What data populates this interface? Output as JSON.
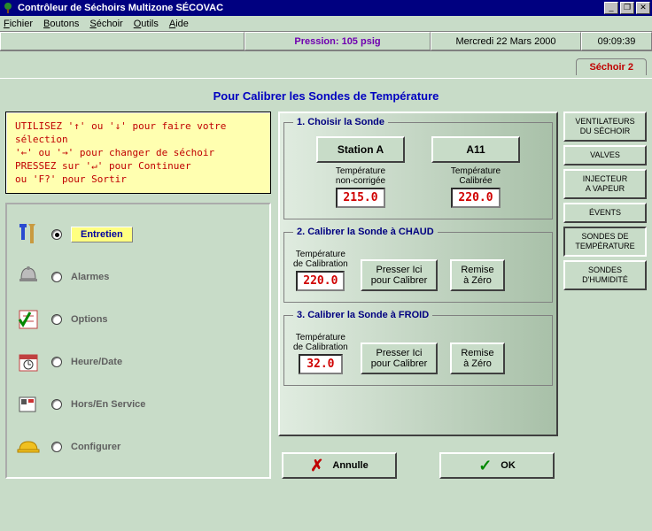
{
  "window": {
    "title": "Contrôleur de Séchoirs Multizone SÉCOVAC"
  },
  "menubar": [
    "Fichier",
    "Boutons",
    "Séchoir",
    "Outils",
    "Aide"
  ],
  "status": {
    "pressure": "Pression: 105 psig",
    "date": "Mercredi 22 Mars 2000",
    "time": "09:09:39"
  },
  "tab": {
    "label": "Séchoir 2"
  },
  "page_title": "Pour Calibrer les Sondes de Température",
  "help_text": "UTILISEZ '↑' ou '↓' pour faire votre sélection\n        '←' ou '→' pour changer de séchoir\nPRESSEZ sur '↵' pour Continuer\n        ou 'F?' pour Sortir",
  "nav": [
    {
      "label": "Entretien",
      "selected": true
    },
    {
      "label": "Alarmes",
      "selected": false
    },
    {
      "label": "Options",
      "selected": false
    },
    {
      "label": "Heure/Date",
      "selected": false
    },
    {
      "label": "Hors/En Service",
      "selected": false
    },
    {
      "label": "Configurer",
      "selected": false
    }
  ],
  "group1": {
    "legend": "1. Choisir la Sonde",
    "station_btn": "Station A",
    "station_sub": "Température\nnon-corrigée",
    "station_val": "215.0",
    "probe_btn": "A11",
    "probe_sub": "Température\nCalibrée",
    "probe_val": "220.0"
  },
  "group2": {
    "legend": "2. Calibrer la Sonde à CHAUD",
    "cal_label": "Température\nde Calibration",
    "cal_val": "220.0",
    "press_btn": "Presser Ici\npour Calibrer",
    "reset_btn": "Remise\nà Zéro"
  },
  "group3": {
    "legend": "3. Calibrer la Sonde à FROID",
    "cal_label": "Température\nde Calibration",
    "cal_val": "32.0",
    "press_btn": "Presser Ici\npour Calibrer",
    "reset_btn": "Remise\nà Zéro"
  },
  "side_buttons": [
    "VENTILATEURS\nDU SÉCHOIR",
    "VALVES",
    "INJECTEUR\nA VAPEUR",
    "ÉVENTS",
    "SONDES DE\nTEMPÉRATURE",
    "SONDES\nD'HUMIDITÉ"
  ],
  "side_active_index": 4,
  "buttons": {
    "cancel": "Annulle",
    "ok": "OK"
  }
}
